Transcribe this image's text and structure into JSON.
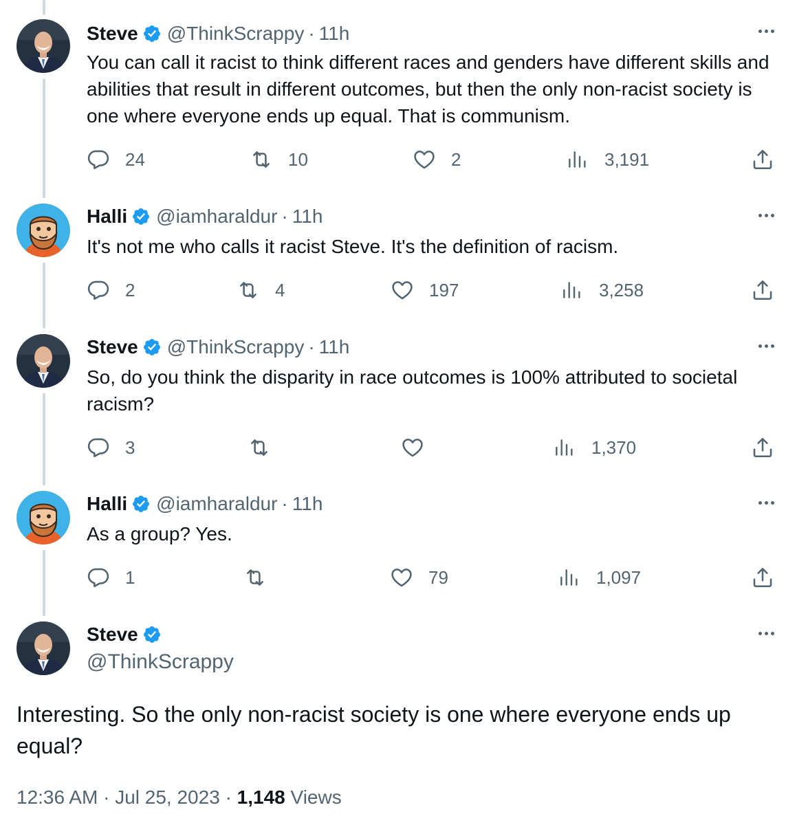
{
  "colors": {
    "verified": "#1d9bf0",
    "secondary_text": "#536471",
    "thread_line": "#cfd9de"
  },
  "replies": [
    {
      "name": "Steve",
      "handle": "@ThinkScrappy",
      "separator": "·",
      "time": "11h",
      "text": "You can call it racist to think different races and genders have different skills and abilities that result in different outcomes, but then the only non-racist society is one where everyone ends up equal.  That is communism.",
      "counts": {
        "replies": "24",
        "retweets": "10",
        "likes": "2",
        "views": "3,191"
      },
      "avatar_icon": "steve-avatar"
    },
    {
      "name": "Halli",
      "handle": "@iamharaldur",
      "separator": "·",
      "time": "11h",
      "text": "It's not me who calls it racist Steve. It's the definition of racism.",
      "counts": {
        "replies": "2",
        "retweets": "4",
        "likes": "197",
        "views": "3,258"
      },
      "avatar_icon": "halli-cartoon-avatar"
    },
    {
      "name": "Steve",
      "handle": "@ThinkScrappy",
      "separator": "·",
      "time": "11h",
      "text": "So, do you think the disparity in race outcomes is 100% attributed to societal racism?",
      "counts": {
        "replies": "3",
        "retweets": "",
        "likes": "",
        "views": "1,370"
      },
      "avatar_icon": "steve-avatar"
    },
    {
      "name": "Halli",
      "handle": "@iamharaldur",
      "separator": "·",
      "time": "11h",
      "text": "As a group? Yes.",
      "counts": {
        "replies": "1",
        "retweets": "",
        "likes": "79",
        "views": "1,097"
      },
      "avatar_icon": "halli-cartoon-avatar"
    }
  ],
  "main_tweet": {
    "name": "Steve",
    "handle": "@ThinkScrappy",
    "text": "Interesting. So the only non-racist society is one where everyone ends up equal?",
    "time": "12:36 AM",
    "date": "Jul 25, 2023",
    "separator": "·",
    "views_count": "1,148",
    "views_label": "Views"
  },
  "icons": [
    "verified-badge-icon",
    "more-options-icon",
    "reply-icon",
    "retweet-icon",
    "like-icon",
    "views-icon",
    "share-icon"
  ]
}
